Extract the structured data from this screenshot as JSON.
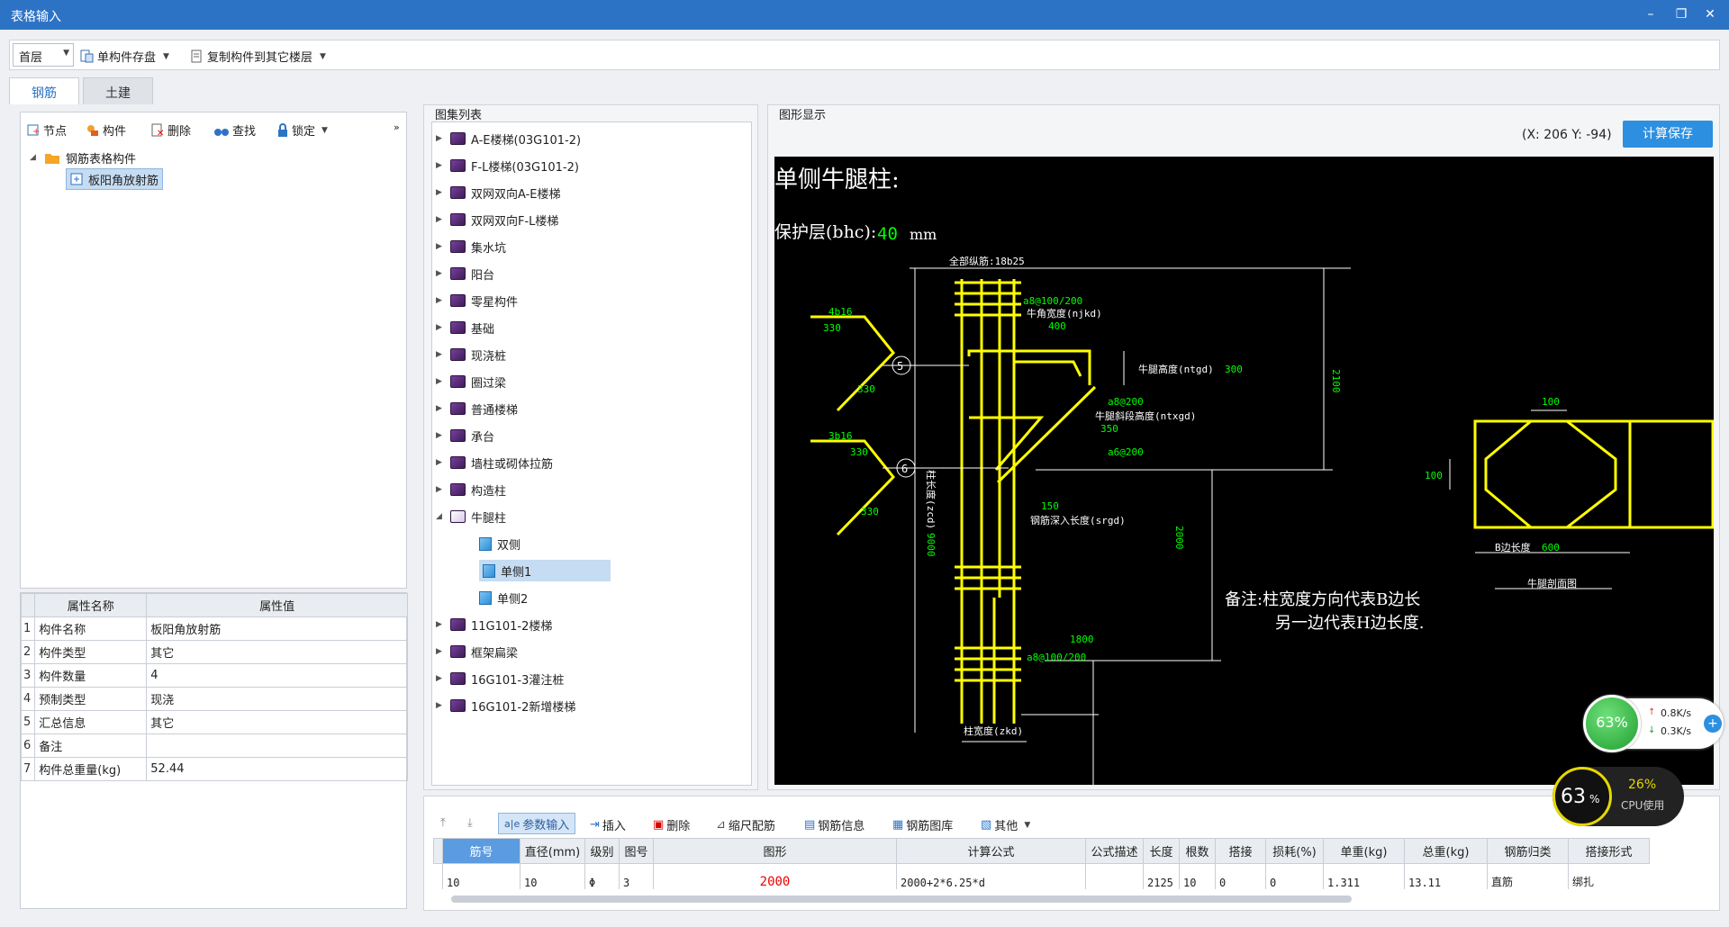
{
  "window": {
    "title": "表格输入"
  },
  "toolbar": {
    "floor": "首层",
    "save_single": "单构件存盘",
    "copy_to_floor": "复制构件到其它楼层"
  },
  "tabs": [
    {
      "label": "钢筋"
    },
    {
      "label": "土建"
    }
  ],
  "left_toolbar": {
    "node": "节点",
    "component": "构件",
    "delete": "删除",
    "find": "查找",
    "lock": "锁定"
  },
  "component_tree": {
    "root": "钢筋表格构件",
    "child": "板阳角放射筋"
  },
  "properties": {
    "headers": [
      "属性名称",
      "属性值"
    ],
    "rows": [
      {
        "n": "1",
        "name": "构件名称",
        "value": "板阳角放射筋"
      },
      {
        "n": "2",
        "name": "构件类型",
        "value": "其它"
      },
      {
        "n": "3",
        "name": "构件数量",
        "value": "4"
      },
      {
        "n": "4",
        "name": "预制类型",
        "value": "现浇"
      },
      {
        "n": "5",
        "name": "汇总信息",
        "value": "其它"
      },
      {
        "n": "6",
        "name": "备注",
        "value": ""
      },
      {
        "n": "7",
        "name": "构件总重量(kg)",
        "value": "52.44"
      }
    ]
  },
  "atlas": {
    "header": "图集列表",
    "items": [
      "A-E楼梯(03G101-2)",
      "F-L楼梯(03G101-2)",
      "双网双向A-E楼梯",
      "双网双向F-L楼梯",
      "集水坑",
      "阳台",
      "零星构件",
      "基础",
      "现浇桩",
      "圈过梁",
      "普通楼梯",
      "承台",
      "墙柱或砌体拉筋",
      "构造柱",
      "牛腿柱"
    ],
    "sub_items": [
      "双侧",
      "单侧1",
      "单侧2"
    ],
    "after_items": [
      "11G101-2楼梯",
      "框架扁梁",
      "16G101-3灌注桩",
      "16G101-2新增楼梯"
    ]
  },
  "graphic": {
    "header": "图形显示",
    "coord": "(X: 206 Y: -94)",
    "save_button": "计算保存",
    "title": "单侧牛腿柱:",
    "cover_label": "保护层(bhc):",
    "cover_value": "40",
    "cover_unit": "mm",
    "labels": {
      "all_rebar": "全部纵筋:18b25",
      "stirrup_top": "a8@100/200",
      "corbel_width": "牛角宽度(njkd)",
      "w400": "400",
      "corbel_height": "牛腿高度(ntgd)",
      "h300": "300",
      "a8_200": "a8@200",
      "slope_height": "牛腿斜段高度(ntxgd)",
      "h350": "350",
      "a6_200": "a6@200",
      "d150": "150",
      "anchor_len": "钢筋深入长度(srgd)",
      "d2100": "2100",
      "d2000": "2000",
      "d1800": "1800",
      "a8_100_200": "a8@100/200",
      "col_height": "柱长度(zcd)",
      "d9000": "9000",
      "col_width": "柱宽度(zkd)",
      "r4b16": "4b16",
      "r3b16": "3b16",
      "d330": "330",
      "circle5": "5",
      "circle6": "6",
      "note1": "备注:柱宽度方向代表B边长",
      "note2": "另一边代表H边长度.",
      "sec_100_top": "100",
      "sec_100_left": "100",
      "b_len": "B边长度",
      "b_600": "600",
      "section": "牛腿剖面图"
    }
  },
  "bottom_toolbar": {
    "param_input": "参数输入",
    "insert": "插入",
    "delete": "删除",
    "scale": "缩尺配筋",
    "info": "钢筋信息",
    "library": "钢筋图库",
    "other": "其他"
  },
  "rebar_table": {
    "headers": [
      "筋号",
      "直径(mm)",
      "级别",
      "图号",
      "图形",
      "计算公式",
      "公式描述",
      "长度",
      "根数",
      "搭接",
      "损耗(%)",
      "单重(kg)",
      "总重(kg)",
      "钢筋归类",
      "搭接形式"
    ],
    "rows": [
      {
        "no": "10",
        "diameter": "10",
        "grade": "Φ",
        "fig": "3",
        "shape": "2000",
        "formula": "2000+2*6.25*d",
        "desc": "",
        "length": "2125",
        "count": "10",
        "lap": "0",
        "loss": "0",
        "unit_w": "1.311",
        "total_w": "13.11",
        "category": "直筋",
        "lap_type": "绑扎"
      }
    ]
  },
  "widgets": {
    "mem_percent": "63%",
    "up_speed": "0.8K/s",
    "down_speed": "0.3K/s",
    "cpu_big": "63",
    "cpu_big_unit": "%",
    "cpu_percent": "26%",
    "cpu_label": "CPU使用"
  },
  "colors": {
    "titlebar": "#2d73c5",
    "button": "#2d8fe0",
    "drawing_yellow": "#ffff00",
    "drawing_green": "#00ff00",
    "drawing_white": "#ffffff"
  }
}
